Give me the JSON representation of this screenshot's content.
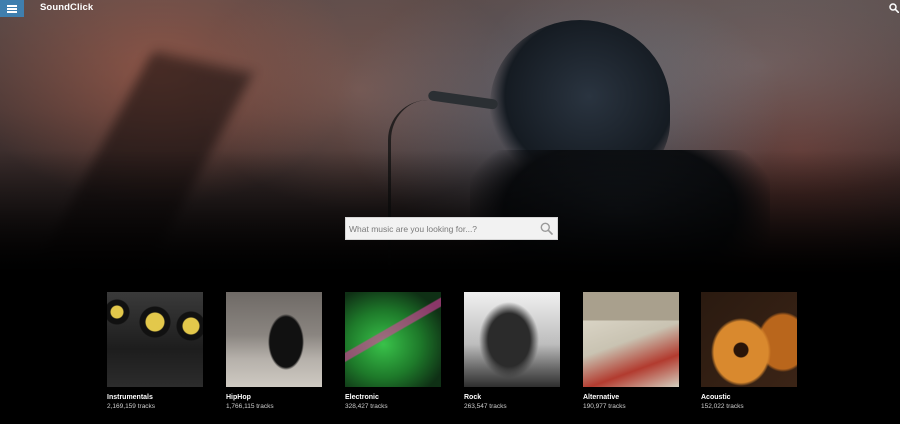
{
  "app": {
    "brand": "SoundClick"
  },
  "header": {
    "menu_icon": "hamburger-menu-icon",
    "search_icon": "search-icon",
    "accent_color": "#3f7fae"
  },
  "search": {
    "placeholder": "What music are you looking for...?",
    "value": "",
    "icon": "search-icon"
  },
  "genres": [
    {
      "name": "Instrumentals",
      "count": "2,169,159 tracks"
    },
    {
      "name": "HipHop",
      "count": "1,766,115 tracks"
    },
    {
      "name": "Electronic",
      "count": "328,427 tracks"
    },
    {
      "name": "Rock",
      "count": "263,547 tracks"
    },
    {
      "name": "Alternative",
      "count": "190,977 tracks"
    },
    {
      "name": "Acoustic",
      "count": "152,022 tracks"
    }
  ]
}
